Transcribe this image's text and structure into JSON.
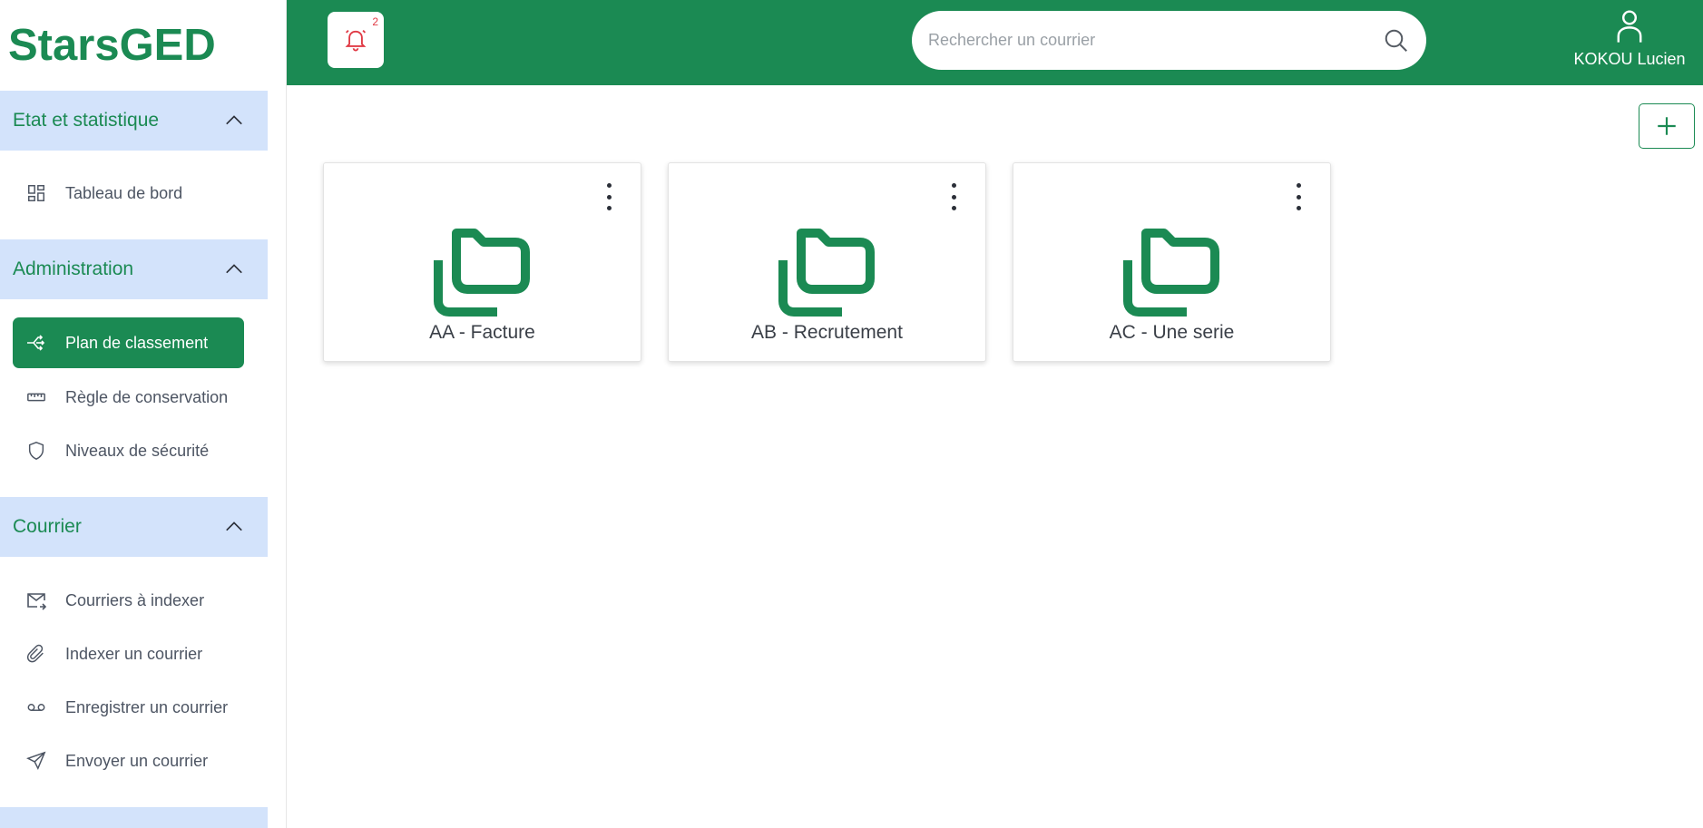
{
  "brand": "StarsGED",
  "sidebar": {
    "sections": [
      {
        "title": "Etat et statistique",
        "items": [
          {
            "label": "Tableau de bord",
            "icon": "dashboard-icon"
          }
        ]
      },
      {
        "title": "Administration",
        "items": [
          {
            "label": "Plan de classement",
            "icon": "classification-tree-icon",
            "active": true
          },
          {
            "label": "Règle de conservation",
            "icon": "ruler-icon"
          },
          {
            "label": "Niveaux de sécurité",
            "icon": "shield-icon"
          }
        ]
      },
      {
        "title": "Courrier",
        "items": [
          {
            "label": "Courriers à indexer",
            "icon": "mail-forward-icon"
          },
          {
            "label": "Indexer un courrier",
            "icon": "paperclip-icon"
          },
          {
            "label": "Enregistrer un courrier",
            "icon": "voicemail-icon"
          },
          {
            "label": "Envoyer un courrier",
            "icon": "send-icon"
          }
        ]
      }
    ]
  },
  "header": {
    "notifications_count": "2",
    "search_placeholder": "Rechercher un courrier",
    "search_value": "",
    "user_name": "KOKOU Lucien"
  },
  "main": {
    "cards": [
      {
        "title": "AA - Facture"
      },
      {
        "title": "AB - Recrutement"
      },
      {
        "title": "AC - Une serie"
      }
    ]
  },
  "colors": {
    "brand_green": "#1b8a53",
    "section_bg": "#d3e3fb",
    "bell_red": "#e03a45"
  }
}
